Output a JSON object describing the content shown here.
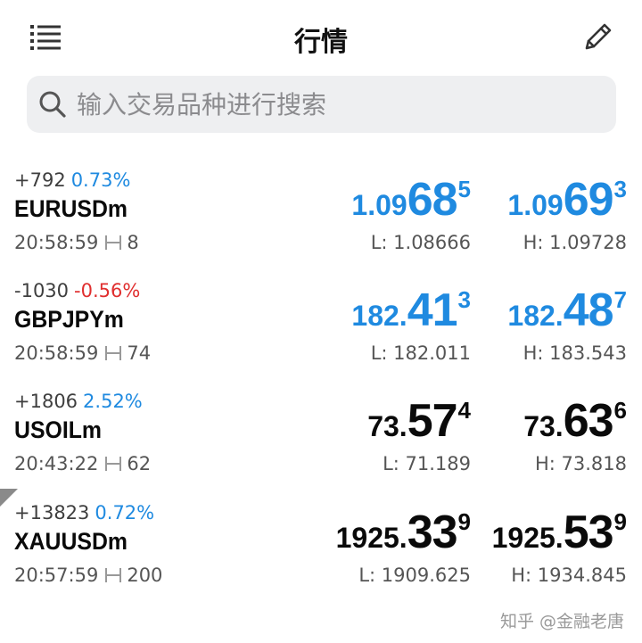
{
  "header": {
    "title": "行情",
    "menu_icon": "list-menu-icon",
    "edit_icon": "pencil-icon"
  },
  "search": {
    "placeholder": "输入交易品种进行搜索",
    "icon": "search-icon"
  },
  "colors": {
    "up": "#1f8ae0",
    "down": "#e02f2f",
    "neutral_quote": "#0a0a0a",
    "search_bg": "#eeeff1"
  },
  "quotes": [
    {
      "change": "+792",
      "percent": "0.73%",
      "direction": "up",
      "symbol": "EURUSDm",
      "time": "20:58:59",
      "spread": "8",
      "quote_color": "blue",
      "bid": {
        "pre": "1.09",
        "big": "68",
        "pip": "5"
      },
      "ask": {
        "pre": "1.09",
        "big": "69",
        "pip": "3"
      },
      "low": "L: 1.08666",
      "high": "H: 1.09728"
    },
    {
      "change": "-1030",
      "percent": "-0.56%",
      "direction": "down",
      "symbol": "GBPJPYm",
      "time": "20:58:59",
      "spread": "74",
      "quote_color": "blue",
      "bid": {
        "pre": "182.",
        "big": "41",
        "pip": "3"
      },
      "ask": {
        "pre": "182.",
        "big": "48",
        "pip": "7"
      },
      "low": "L: 182.011",
      "high": "H: 183.543"
    },
    {
      "change": "+1806",
      "percent": "2.52%",
      "direction": "up",
      "symbol": "USOILm",
      "time": "20:43:22",
      "spread": "62",
      "quote_color": "black",
      "bid": {
        "pre": "73.",
        "big": "57",
        "pip": "4"
      },
      "ask": {
        "pre": "73.",
        "big": "63",
        "pip": "6"
      },
      "low": "L: 71.189",
      "high": "H: 73.818"
    },
    {
      "change": "+13823",
      "percent": "0.72%",
      "direction": "up",
      "symbol": "XAUUSDm",
      "time": "20:57:59",
      "spread": "200",
      "quote_color": "black",
      "bid": {
        "pre": "1925.",
        "big": "33",
        "pip": "9"
      },
      "ask": {
        "pre": "1925.",
        "big": "53",
        "pip": "9"
      },
      "low": "L: 1909.625",
      "high": "H: 1934.845"
    }
  ],
  "watermark": "知乎 @金融老唐"
}
